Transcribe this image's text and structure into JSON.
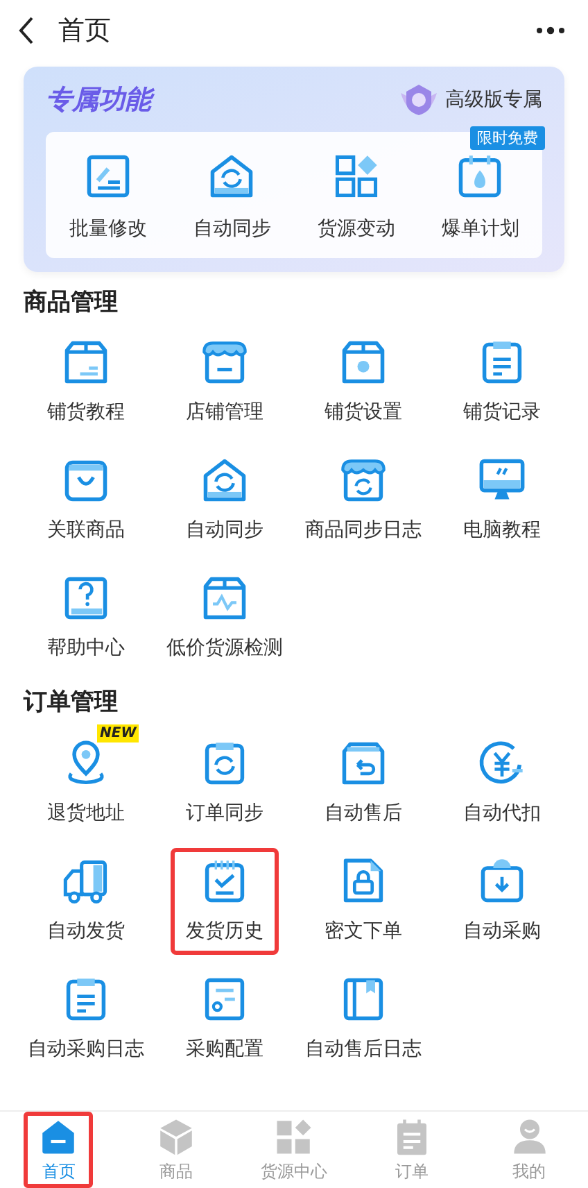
{
  "header": {
    "title": "首页"
  },
  "premium": {
    "title": "专属功能",
    "badge": "高级版专属",
    "items": [
      {
        "label": "批量修改"
      },
      {
        "label": "自动同步"
      },
      {
        "label": "货源变动"
      },
      {
        "label": "爆单计划",
        "tag": "限时免费"
      }
    ]
  },
  "sections": [
    {
      "title": "商品管理",
      "items": [
        {
          "label": "铺货教程",
          "highlighted": false
        },
        {
          "label": "店铺管理",
          "highlighted": false
        },
        {
          "label": "铺货设置",
          "highlighted": false
        },
        {
          "label": "铺货记录",
          "highlighted": false
        },
        {
          "label": "关联商品",
          "highlighted": false
        },
        {
          "label": "自动同步",
          "highlighted": false
        },
        {
          "label": "商品同步日志",
          "highlighted": false
        },
        {
          "label": "电脑教程",
          "highlighted": false
        },
        {
          "label": "帮助中心",
          "highlighted": false
        },
        {
          "label": "低价货源检测",
          "highlighted": false
        }
      ]
    },
    {
      "title": "订单管理",
      "items": [
        {
          "label": "退货地址",
          "badge": "NEW",
          "highlighted": false
        },
        {
          "label": "订单同步",
          "highlighted": false
        },
        {
          "label": "自动售后",
          "highlighted": false
        },
        {
          "label": "自动代扣",
          "highlighted": false
        },
        {
          "label": "自动发货",
          "highlighted": false
        },
        {
          "label": "发货历史",
          "highlighted": true
        },
        {
          "label": "密文下单",
          "highlighted": false
        },
        {
          "label": "自动采购",
          "highlighted": false
        },
        {
          "label": "自动采购日志",
          "highlighted": false
        },
        {
          "label": "采购配置",
          "highlighted": false
        },
        {
          "label": "自动售后日志",
          "highlighted": false
        }
      ]
    }
  ],
  "tabbar": [
    {
      "label": "首页",
      "selected": true,
      "highlighted": true
    },
    {
      "label": "商品",
      "selected": false,
      "highlighted": false
    },
    {
      "label": "货源中心",
      "selected": false,
      "highlighted": false
    },
    {
      "label": "订单",
      "selected": false,
      "highlighted": false
    },
    {
      "label": "我的",
      "selected": false,
      "highlighted": false
    }
  ]
}
